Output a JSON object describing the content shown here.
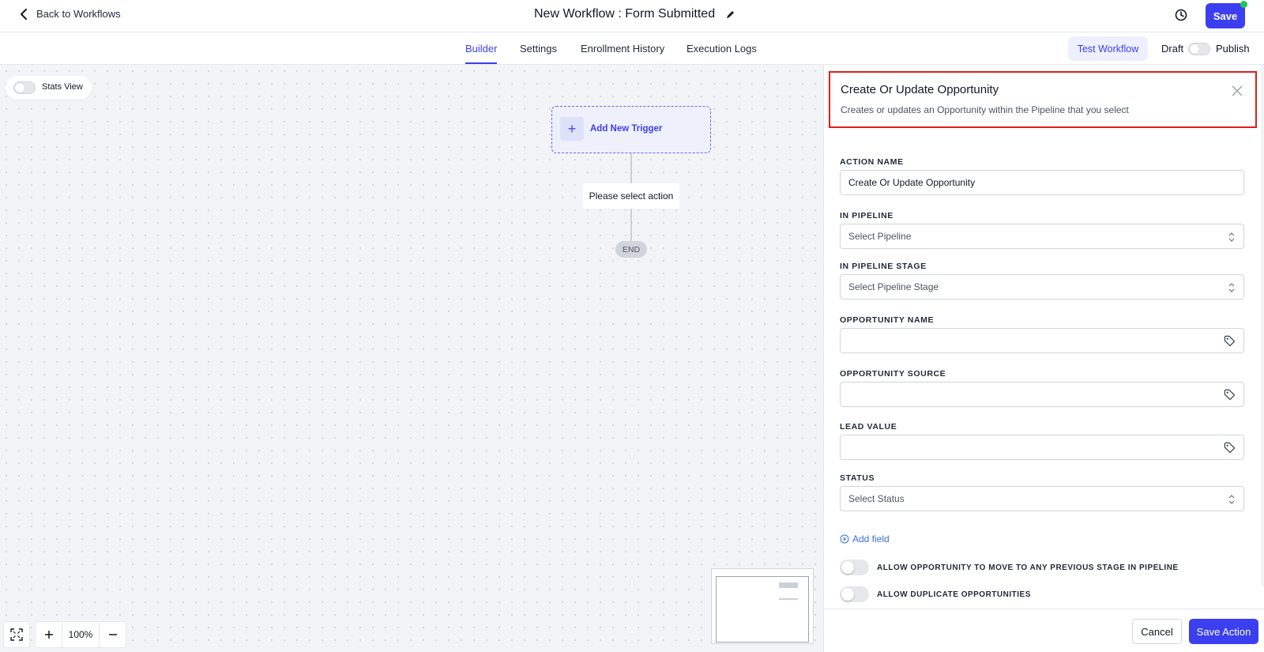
{
  "header": {
    "back_label": "Back to Workflows",
    "workflow_title": "New Workflow : Form Submitted",
    "save_label": "Save"
  },
  "tabs": [
    {
      "label": "Builder",
      "active": true
    },
    {
      "label": "Settings",
      "active": false
    },
    {
      "label": "Enrollment History",
      "active": false
    },
    {
      "label": "Execution Logs",
      "active": false
    }
  ],
  "toolbar": {
    "test_label": "Test Workflow",
    "draft_label": "Draft",
    "publish_label": "Publish"
  },
  "canvas": {
    "stats_label": "Stats View",
    "trigger_label": "Add New Trigger",
    "action_label": "Please select action",
    "end_label": "END",
    "zoom_level": "100%"
  },
  "panel": {
    "title": "Create Or Update Opportunity",
    "description": "Creates or updates an Opportunity within the Pipeline that you select",
    "fields": {
      "action_name": {
        "label": "ACTION NAME",
        "value": "Create Or Update Opportunity"
      },
      "pipeline": {
        "label": "IN PIPELINE",
        "placeholder": "Select Pipeline"
      },
      "pipeline_stage": {
        "label": "IN PIPELINE STAGE",
        "placeholder": "Select Pipeline Stage"
      },
      "opportunity_name": {
        "label": "OPPORTUNITY NAME",
        "value": ""
      },
      "opportunity_source": {
        "label": "OPPORTUNITY SOURCE",
        "value": ""
      },
      "lead_value": {
        "label": "LEAD VALUE",
        "value": ""
      },
      "status": {
        "label": "STATUS",
        "placeholder": "Select Status"
      }
    },
    "add_field_label": "Add field",
    "toggles": {
      "allow_move": "ALLOW OPPORTUNITY TO MOVE TO ANY PREVIOUS STAGE IN PIPELINE",
      "allow_duplicates": "ALLOW DUPLICATE OPPORTUNITIES"
    },
    "cancel_label": "Cancel",
    "save_action_label": "Save Action"
  },
  "colors": {
    "primary": "#3b3ff0",
    "highlight_border": "#e11d1d",
    "canvas_bg": "#f3f4f8",
    "status_dot": "#22c55e"
  }
}
